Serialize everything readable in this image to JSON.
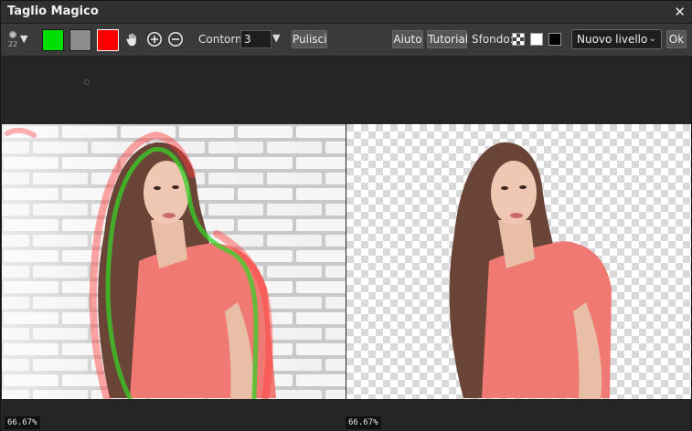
{
  "window": {
    "title": "Taglio Magico",
    "close_label": "✕"
  },
  "toolbar": {
    "brush_size": "22",
    "contour_label": "Contorno",
    "contour_value": "3",
    "clear_button": "Pulisci",
    "help_button": "Aiuto",
    "tutorial_button": "Tutorial",
    "background_label": "Sfondo:",
    "output_select": "Nuovo livello",
    "ok_button": "Ok",
    "colors": {
      "keep_green": "#00e000",
      "neutral_gray": "#8c8c8c",
      "remove_red": "#ff0000"
    },
    "icons": [
      "brush-size-icon",
      "hand-icon",
      "zoom-in-icon",
      "zoom-out-icon",
      "checkerboard-icon"
    ]
  },
  "editor": {
    "left_zoom": "66.67%",
    "right_zoom": "66.67%"
  }
}
